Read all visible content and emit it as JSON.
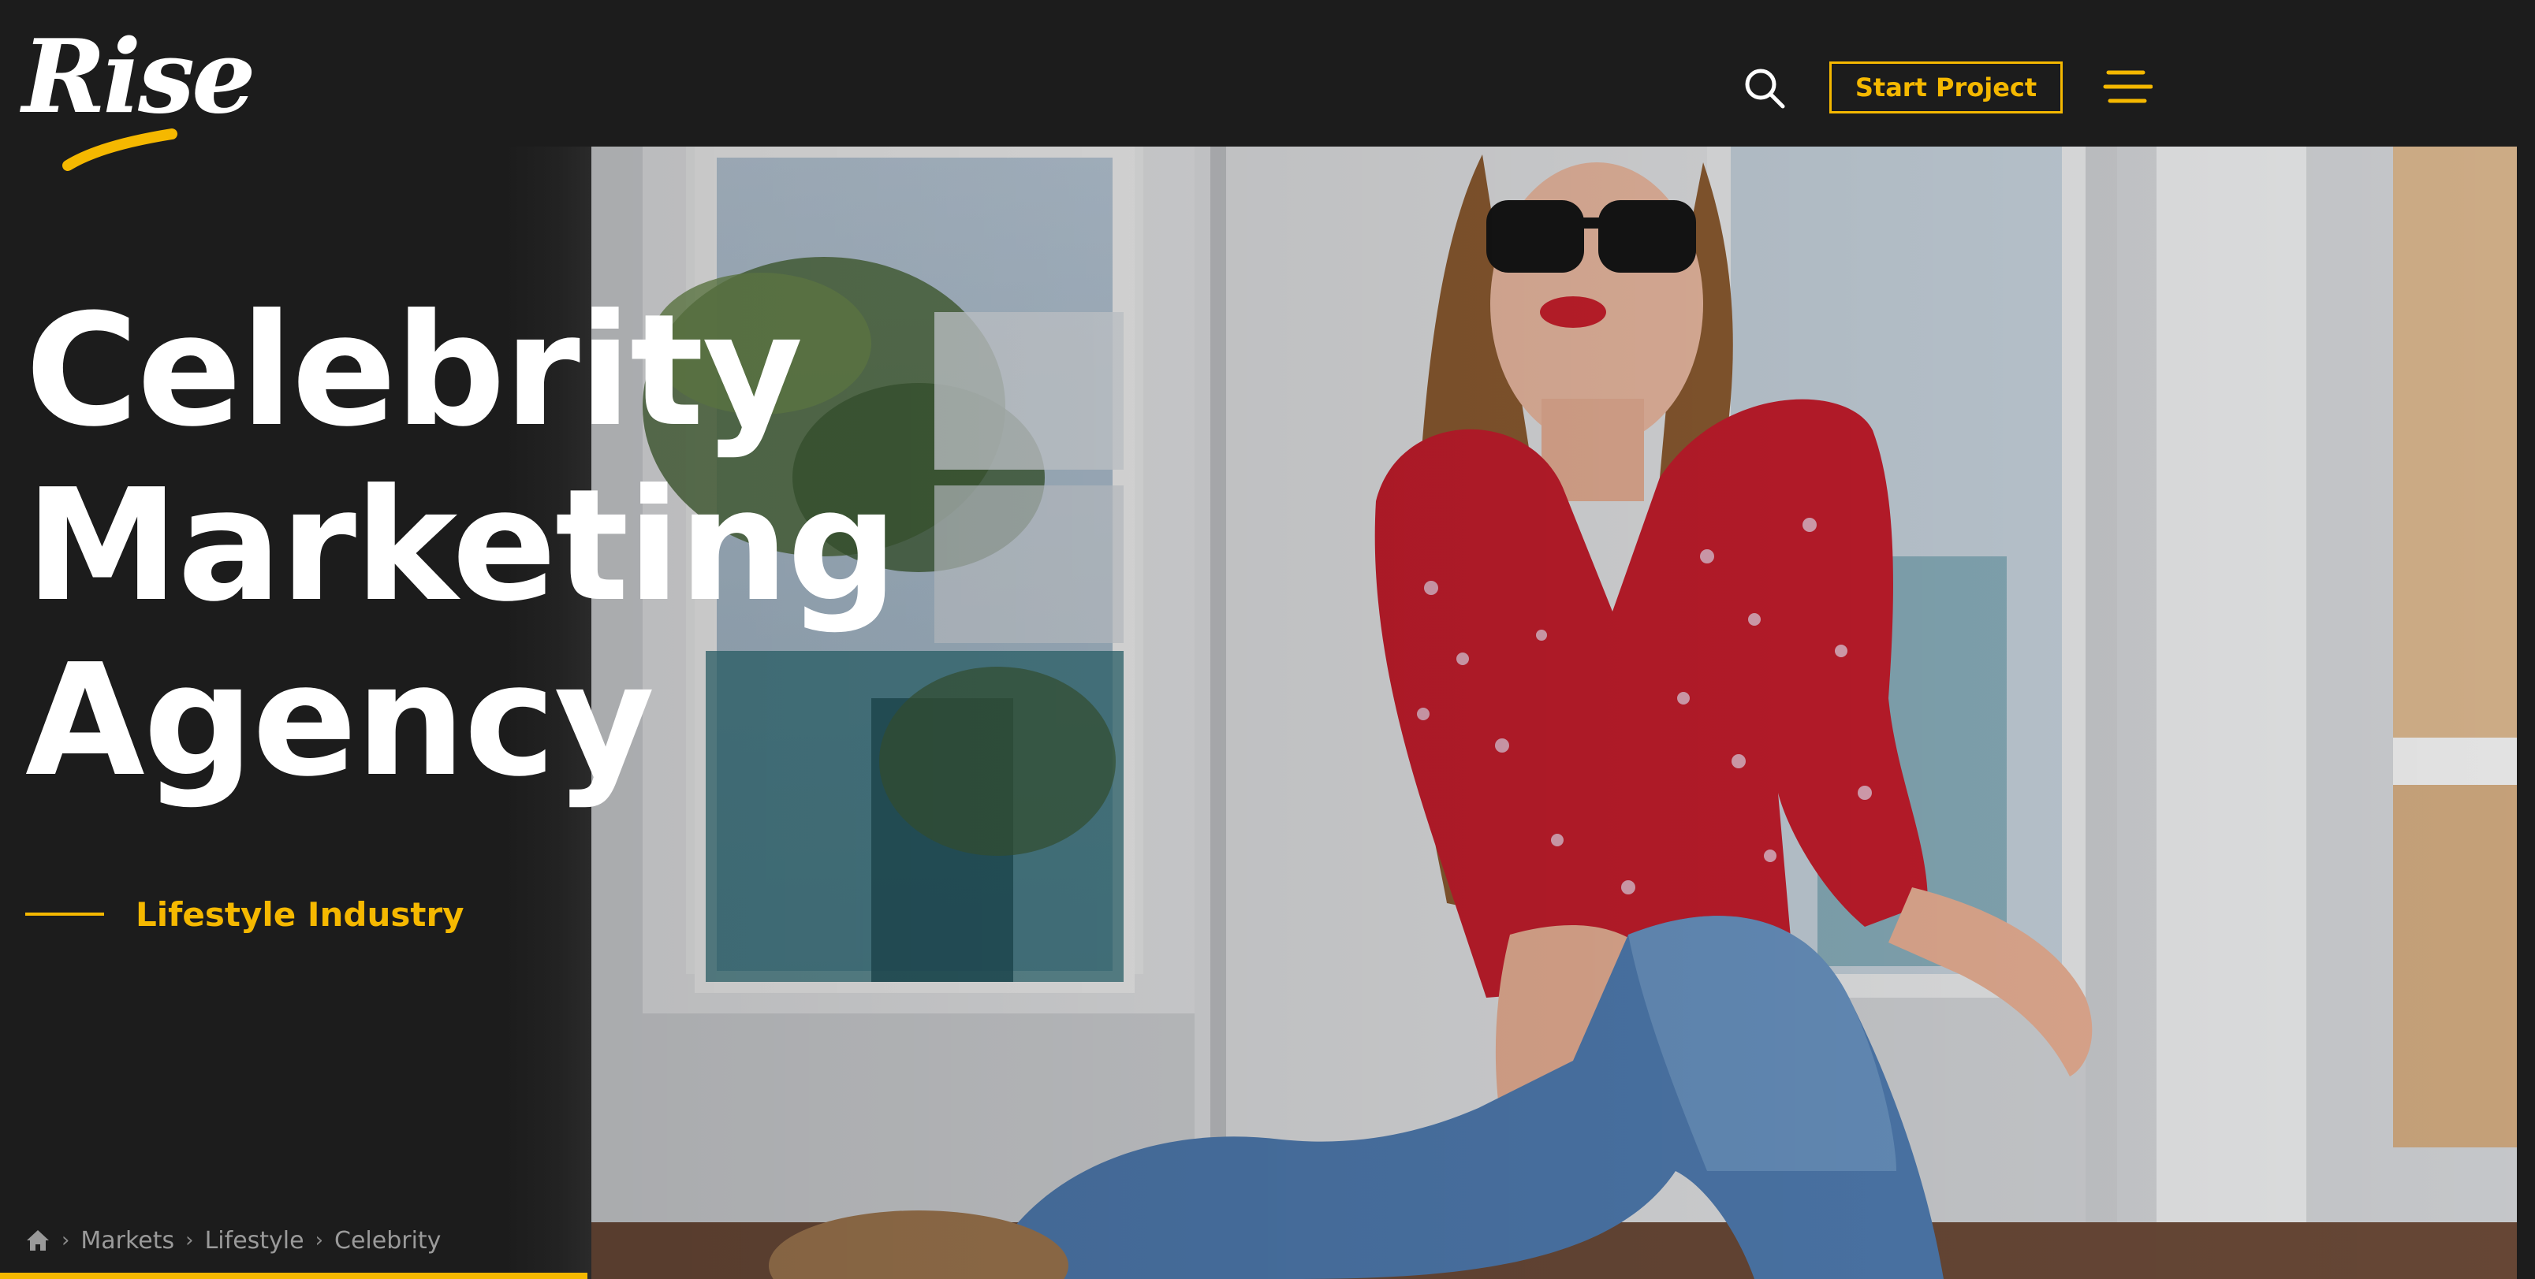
{
  "brand": {
    "logo_text": "Rise",
    "accent_color": "#f5b800"
  },
  "header": {
    "search_icon": "search-icon",
    "start_project_label": "Start Project",
    "menu_icon": "hamburger-menu-icon"
  },
  "hero": {
    "title_lines": [
      "Celebrity",
      "Marketing",
      "Agency"
    ],
    "industry_label": "Lifestyle Industry",
    "photo": "woman-sunglasses-red-blouse-jeans"
  },
  "breadcrumb": {
    "home_icon": "home-icon",
    "items": [
      "Markets",
      "Lifestyle",
      "Celebrity"
    ]
  }
}
